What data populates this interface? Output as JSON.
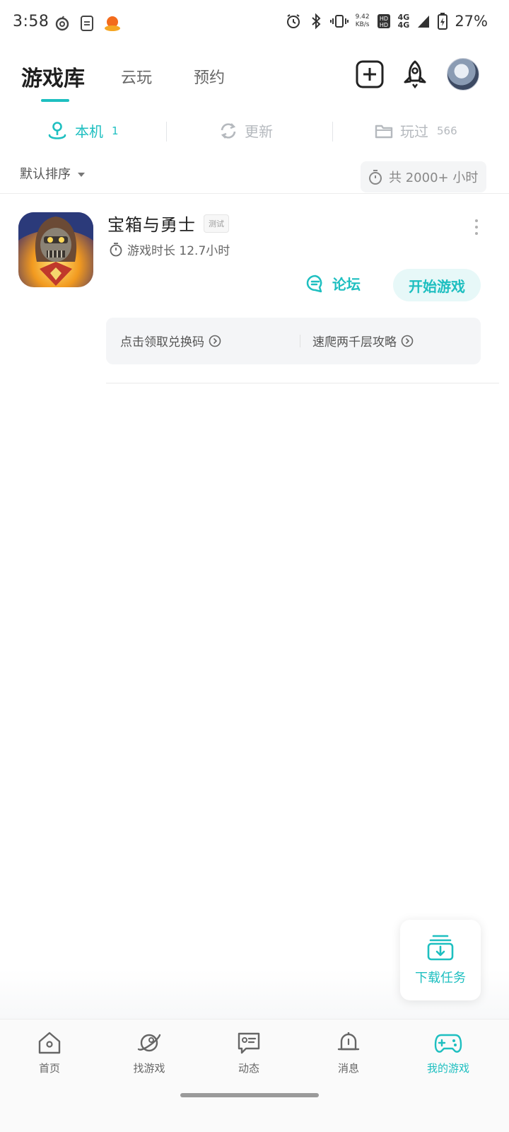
{
  "status_bar": {
    "time": "3:58",
    "net_speed_value": "9.42",
    "net_speed_unit": "KB/s",
    "signal_1": "4G",
    "signal_2": "4G",
    "battery": "27%"
  },
  "header": {
    "tabs": [
      {
        "label": "游戏库",
        "active": true
      },
      {
        "label": "云玩",
        "active": false
      },
      {
        "label": "预约",
        "active": false
      }
    ],
    "accent_color": "#1ebfc0"
  },
  "subtabs": [
    {
      "label": "本机",
      "count": "1",
      "icon": "user-pin-icon",
      "active": true
    },
    {
      "label": "更新",
      "count": "",
      "icon": "refresh-icon",
      "active": false
    },
    {
      "label": "玩过",
      "count": "566",
      "icon": "folder-icon",
      "active": false
    }
  ],
  "sort": {
    "label": "默认排序",
    "total_time": "共 2000+ 小时"
  },
  "games": [
    {
      "title": "宝箱与勇士",
      "badge": "测试",
      "play_time": "游戏时长 12.7小时",
      "forum_label": "论坛",
      "start_label": "开始游戏",
      "promos": [
        "点击领取兑换码",
        "速爬两千层攻略"
      ]
    }
  ],
  "fab": {
    "label": "下载任务",
    "icon": "download-tray-icon"
  },
  "bottom_nav": [
    {
      "label": "首页",
      "icon": "home-icon",
      "active": false
    },
    {
      "label": "找游戏",
      "icon": "planet-icon",
      "active": false
    },
    {
      "label": "动态",
      "icon": "chat-card-icon",
      "active": false
    },
    {
      "label": "消息",
      "icon": "bell-icon",
      "active": false
    },
    {
      "label": "我的游戏",
      "icon": "gamepad-icon",
      "active": true
    }
  ]
}
